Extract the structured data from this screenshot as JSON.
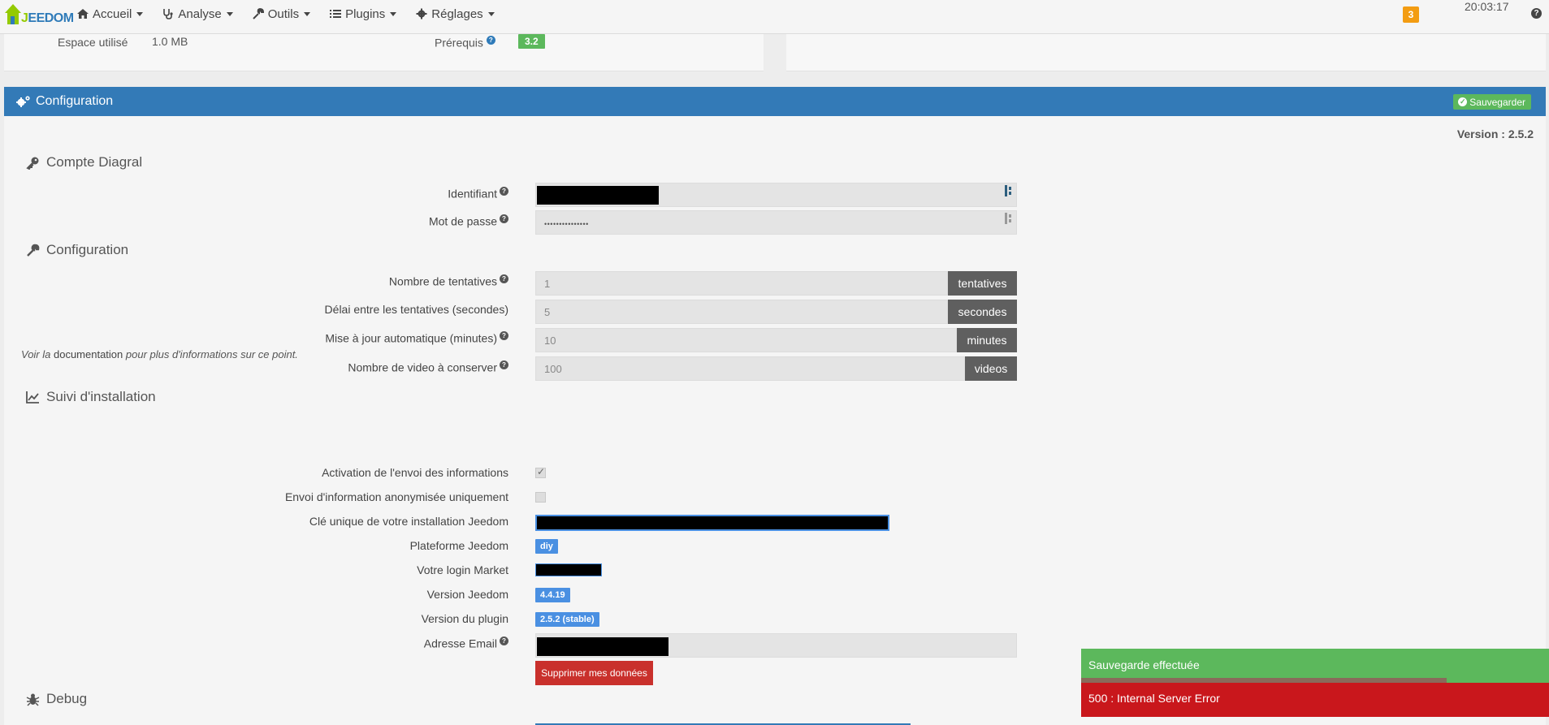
{
  "navbar": {
    "logo_text_1": "J",
    "logo_text_2": "EEDOM",
    "menu": [
      {
        "label": "Accueil",
        "icon": "home-icon"
      },
      {
        "label": "Analyse",
        "icon": "stethoscope-icon"
      },
      {
        "label": "Outils",
        "icon": "wrench-icon"
      },
      {
        "label": "Plugins",
        "icon": "list-icon"
      },
      {
        "label": "Réglages",
        "icon": "gear-icon"
      }
    ],
    "notification_count": "3",
    "clock": "20:03:17",
    "help": "?"
  },
  "info_panel": {
    "space_label": "Espace utilisé",
    "space_value": "1.0 MB",
    "prereq_label": "Prérequis",
    "prereq_value": "3.2"
  },
  "config": {
    "title": "Configuration",
    "save_label": "Sauvegarder",
    "version": "Version : 2.5.2",
    "sections": {
      "account": "Compte Diagral",
      "configuration": "Configuration",
      "tracking": "Suivi d'installation",
      "debug": "Debug"
    },
    "account": {
      "id_label": "Identifiant",
      "password_label": "Mot de passe",
      "password_value": "•••••••••••••••"
    },
    "settings": {
      "attempts_label": "Nombre de tentatives",
      "attempts_value": "1",
      "attempts_unit": "tentatives",
      "delay_label": "Délai entre les tentatives (secondes)",
      "delay_value": "5",
      "delay_unit": "secondes",
      "update_label": "Mise à jour automatique (minutes)",
      "update_value": "10",
      "update_unit": "minutes",
      "videos_label": "Nombre de video à conserver",
      "videos_value": "100",
      "videos_unit": "videos"
    },
    "tracking": {
      "note_prefix": "Voir la ",
      "note_link": "documentation",
      "note_suffix": " pour plus d'informations sur ce point.",
      "send_label": "Activation de l'envoi des informations",
      "send_checked": true,
      "anon_label": "Envoi d'information anonymisée uniquement",
      "anon_checked": false,
      "key_label": "Clé unique de votre installation Jeedom",
      "platform_label": "Plateforme Jeedom",
      "platform_value": "diy",
      "market_label": "Votre login Market",
      "jeedom_version_label": "Version Jeedom",
      "jeedom_version_value": "4.4.19",
      "plugin_version_label": "Version du plugin",
      "plugin_version_value": "2.5.2 (stable)",
      "email_label": "Adresse Email",
      "delete_label": "Supprimer mes données"
    }
  },
  "toasts": {
    "success": "Sauvegarde effectuée",
    "error": "500 : Internal Server Error"
  },
  "colors": {
    "primary": "#337ab7",
    "success": "#5cb85c",
    "danger": "#c9302c",
    "warning": "#f39c12"
  }
}
